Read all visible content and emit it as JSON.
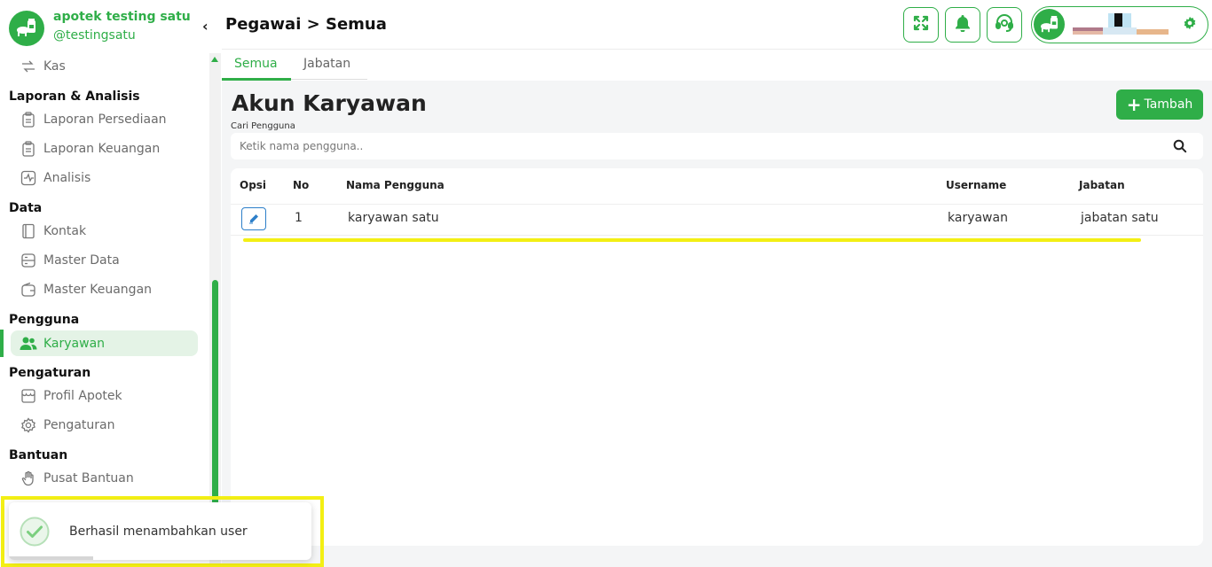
{
  "brand": {
    "name": "apotek testing satu",
    "handle": "@testingsatu"
  },
  "sidebar": {
    "sections": [
      {
        "title": "Laporan & Analisis"
      },
      {
        "title": "Data"
      },
      {
        "title": "Pengguna"
      },
      {
        "title": "Pengaturan"
      },
      {
        "title": "Bantuan"
      }
    ],
    "items": [
      {
        "label": "Kas",
        "icon": "cash-transfer-icon"
      },
      {
        "label": "Laporan Persediaan",
        "icon": "clipboard-icon"
      },
      {
        "label": "Laporan Keuangan",
        "icon": "clipboard-icon"
      },
      {
        "label": "Analisis",
        "icon": "activity-icon"
      },
      {
        "label": "Kontak",
        "icon": "contact-book-icon"
      },
      {
        "label": "Master Data",
        "icon": "database-icon"
      },
      {
        "label": "Master Keuangan",
        "icon": "wallet-icon"
      },
      {
        "label": "Karyawan",
        "icon": "users-icon",
        "active": true
      },
      {
        "label": "Profil Apotek",
        "icon": "store-icon"
      },
      {
        "label": "Pengaturan",
        "icon": "gear-icon"
      },
      {
        "label": "Pusat Bantuan",
        "icon": "hand-icon"
      }
    ]
  },
  "header": {
    "breadcrumb": "Pegawai > Semua"
  },
  "tabs": [
    {
      "label": "Semua",
      "active": true
    },
    {
      "label": "Jabatan"
    }
  ],
  "main": {
    "title": "Akun Karyawan",
    "add_button": "Tambah",
    "search": {
      "label": "Cari Pengguna",
      "placeholder": "Ketik nama pengguna.."
    },
    "table": {
      "columns": [
        "Opsi",
        "No",
        "Nama Pengguna",
        "Username",
        "Jabatan"
      ],
      "rows": [
        {
          "no": "1",
          "nama": "karyawan satu",
          "username": "karyawan",
          "jabatan": "jabatan satu"
        }
      ]
    }
  },
  "toast": {
    "message": "Berhasil menambahkan user",
    "progress": 0.28
  },
  "colors": {
    "accent": "#2fae48",
    "highlight": "#f3ef14",
    "edit": "#2d7fc9"
  }
}
